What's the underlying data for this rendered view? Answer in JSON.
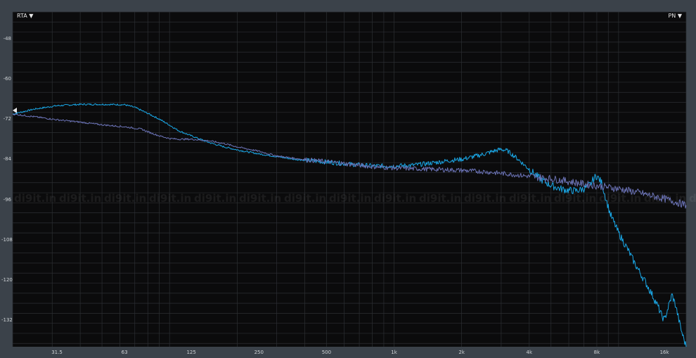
{
  "controls": {
    "rta_label": "RTA ▼",
    "pn_label": "PN ▼"
  },
  "watermark": "di9it.in",
  "colors": {
    "background": "#0b0b0c",
    "frame": "#3b424a",
    "grid": "#2c2f33",
    "series_a": "#1aa7e6",
    "series_b": "#6b73b6"
  },
  "chart_data": {
    "type": "line",
    "xscale": "log",
    "xlim": [
      20,
      20000
    ],
    "ylim": [
      -140,
      -40
    ],
    "yticks": [
      -48,
      -60,
      -72,
      -84,
      -96,
      -108,
      -120,
      -132
    ],
    "ytick_labels": [
      "-48",
      "-60",
      "-72",
      "-84",
      "-96",
      "-108",
      "-120",
      "-132"
    ],
    "xticks": [
      31.5,
      63,
      125,
      250,
      500,
      1000,
      2000,
      4000,
      8000,
      16000
    ],
    "xtick_labels": [
      "31.5",
      "63",
      "125",
      "250",
      "500",
      "1k",
      "2k",
      "4k",
      "8k",
      "16k"
    ],
    "reference_level": -69.5,
    "series": [
      {
        "color": "#1aa7e6",
        "points": [
          [
            20,
            -70.5
          ],
          [
            25,
            -69
          ],
          [
            31.5,
            -68
          ],
          [
            40,
            -67.6
          ],
          [
            50,
            -67.6
          ],
          [
            63,
            -67.7
          ],
          [
            70,
            -68.5
          ],
          [
            80,
            -70.3
          ],
          [
            90,
            -72
          ],
          [
            100,
            -73.8
          ],
          [
            110,
            -75.5
          ],
          [
            125,
            -77
          ],
          [
            150,
            -79
          ],
          [
            175,
            -80.3
          ],
          [
            200,
            -81.2
          ],
          [
            250,
            -82.4
          ],
          [
            300,
            -83.2
          ],
          [
            350,
            -83.9
          ],
          [
            400,
            -84.3
          ],
          [
            500,
            -84.8
          ],
          [
            600,
            -85.3
          ],
          [
            700,
            -85.7
          ],
          [
            800,
            -86
          ],
          [
            1000,
            -86
          ],
          [
            1200,
            -85.8
          ],
          [
            1400,
            -85.3
          ],
          [
            1600,
            -84.8
          ],
          [
            1800,
            -84.3
          ],
          [
            2000,
            -84
          ],
          [
            2200,
            -83.4
          ],
          [
            2500,
            -82.5
          ],
          [
            2800,
            -81.5
          ],
          [
            3000,
            -81
          ],
          [
            3200,
            -81.5
          ],
          [
            3500,
            -83.5
          ],
          [
            4000,
            -87
          ],
          [
            4500,
            -90
          ],
          [
            5000,
            -91.8
          ],
          [
            5500,
            -92.8
          ],
          [
            6000,
            -93.3
          ],
          [
            6500,
            -93.4
          ],
          [
            7000,
            -92.8
          ],
          [
            7500,
            -91.5
          ],
          [
            7800,
            -89.5
          ],
          [
            8000,
            -89
          ],
          [
            8400,
            -91
          ],
          [
            8800,
            -96
          ],
          [
            9200,
            -100.5
          ],
          [
            10000,
            -106
          ],
          [
            11000,
            -111
          ],
          [
            12000,
            -116
          ],
          [
            13000,
            -120
          ],
          [
            14000,
            -124
          ],
          [
            15000,
            -128
          ],
          [
            15500,
            -130.5
          ],
          [
            16000,
            -132
          ],
          [
            16500,
            -129
          ],
          [
            17300,
            -124.5
          ],
          [
            18000,
            -128
          ],
          [
            19000,
            -135
          ],
          [
            20000,
            -140
          ]
        ]
      },
      {
        "color": "#6b73b6",
        "points": [
          [
            20,
            -70.5
          ],
          [
            25,
            -71.3
          ],
          [
            31.5,
            -72.2
          ],
          [
            40,
            -72.9
          ],
          [
            50,
            -73.7
          ],
          [
            63,
            -74.3
          ],
          [
            75,
            -75
          ],
          [
            80,
            -75.8
          ],
          [
            90,
            -77
          ],
          [
            100,
            -77.8
          ],
          [
            110,
            -78
          ],
          [
            125,
            -78
          ],
          [
            150,
            -78.5
          ],
          [
            175,
            -79.3
          ],
          [
            200,
            -80.3
          ],
          [
            250,
            -81.6
          ],
          [
            300,
            -83
          ],
          [
            350,
            -83.6
          ],
          [
            400,
            -84.1
          ],
          [
            500,
            -84.7
          ],
          [
            600,
            -85.3
          ],
          [
            700,
            -85.8
          ],
          [
            800,
            -86.2
          ],
          [
            1000,
            -86.6
          ],
          [
            1200,
            -86.8
          ],
          [
            1500,
            -87
          ],
          [
            2000,
            -87.3
          ],
          [
            2500,
            -87.7
          ],
          [
            3000,
            -88.2
          ],
          [
            4000,
            -89.1
          ],
          [
            5000,
            -89.8
          ],
          [
            6000,
            -90.6
          ],
          [
            7000,
            -91.4
          ],
          [
            8000,
            -91.9
          ],
          [
            10000,
            -92.8
          ],
          [
            12000,
            -93.8
          ],
          [
            14000,
            -94.9
          ],
          [
            16000,
            -95.8
          ],
          [
            18000,
            -96.8
          ],
          [
            20000,
            -97.7
          ]
        ]
      }
    ]
  }
}
